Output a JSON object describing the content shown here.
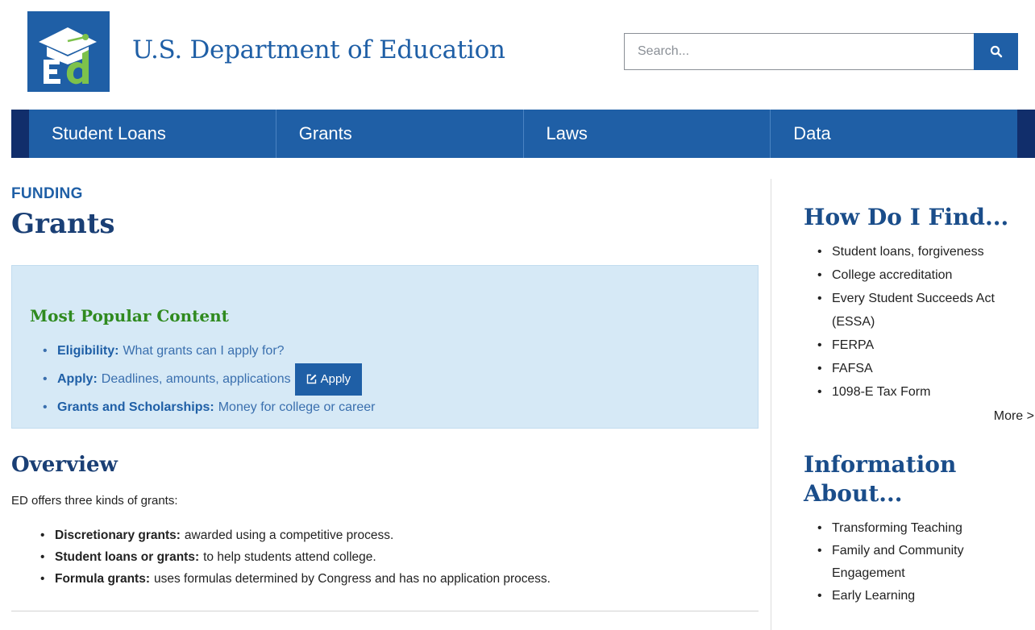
{
  "header": {
    "site_title": "U.S. Department of Education",
    "logo_icon": "ed-logo-icon",
    "search": {
      "placeholder": "Search...",
      "value": "",
      "button_icon": "search-icon"
    }
  },
  "nav": {
    "items": [
      {
        "label": "Student Loans"
      },
      {
        "label": "Grants"
      },
      {
        "label": "Laws"
      },
      {
        "label": "Data"
      }
    ]
  },
  "main": {
    "kicker": "FUNDING",
    "title": "Grants",
    "popular": {
      "heading": "Most Popular Content",
      "items": [
        {
          "link": "Eligibility:",
          "text": "What grants can I apply for?"
        },
        {
          "link": "Apply:",
          "text": "Deadlines, amounts, applications",
          "button": "Apply",
          "button_icon": "edit-icon"
        },
        {
          "link": "Grants and Scholarships:",
          "text": "Money for college or career"
        }
      ]
    },
    "overview": {
      "title": "Overview",
      "intro": "ED offers three kinds of grants:",
      "items": [
        {
          "term": "Discretionary grants:",
          "text": "awarded using a competitive process."
        },
        {
          "term": "Student loans or grants:",
          "text": "to help students attend college."
        },
        {
          "term": "Formula grants:",
          "text": "uses formulas determined by Congress and has no application process."
        }
      ]
    }
  },
  "sidebar": {
    "find_heading": "How Do I Find...",
    "find_items": [
      "Student loans, forgiveness",
      "College accreditation",
      "Every Student Succeeds Act (ESSA)",
      "FERPA",
      "FAFSA",
      "1098-E Tax Form"
    ],
    "more_label": "More >",
    "info_heading": "Information About...",
    "info_items": [
      "Transforming Teaching",
      "Family and Community Engagement",
      "Early Learning"
    ]
  },
  "colors": {
    "brand_blue": "#1f5fa6",
    "nav_edge": "#112e6b",
    "popular_bg": "#d6e9f6",
    "popular_heading": "#2f8a1f"
  }
}
